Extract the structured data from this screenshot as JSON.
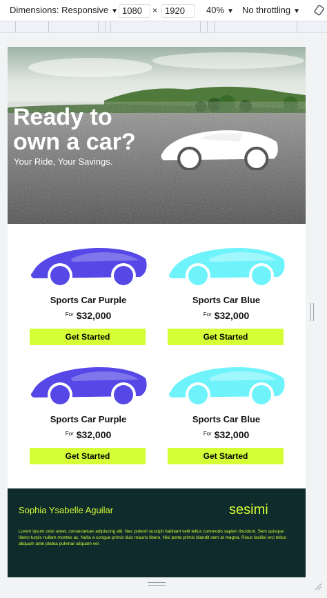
{
  "devtools": {
    "dimensions_label": "Dimensions: Responsive",
    "width_value": "1080",
    "times": "×",
    "height_value": "1920",
    "zoom_label": "40%",
    "throttling_label": "No throttling"
  },
  "hero": {
    "title_line1": "Ready to",
    "title_line2": "own a car?",
    "subtitle": "Your Ride, Your Savings."
  },
  "products": [
    {
      "name": "Sports Car Purple",
      "for": "For",
      "price": "$32,000",
      "button": "Get Started",
      "color": "#5548e6"
    },
    {
      "name": "Sports Car Blue",
      "for": "For",
      "price": "$32,000",
      "button": "Get Started",
      "color": "#6ef3fb"
    },
    {
      "name": "Sports Car Purple",
      "for": "For",
      "price": "$32,000",
      "button": "Get Started",
      "color": "#5548e6"
    },
    {
      "name": "Sports Car Blue",
      "for": "For",
      "price": "$32,000",
      "button": "Get Started",
      "color": "#6ef3fb"
    }
  ],
  "footer": {
    "author": "Sophia Ysabelle Aguilar",
    "brand": "sesimi",
    "lorem": "Lorem ipsum odor amet, consectetuer adipiscing elit. Nec potenti suscipit habitant velit tellus commodo sapien tincidunt. Sem quisque libero turpis nullam montes ac. Nulla a congue primis duis mauris libero. Nisi porta primis blandit sem at magna. Risus facilisi orci tellus aliquam ante platea pulvinar aliquam vel."
  },
  "colors": {
    "accent": "#d4ff36",
    "footer_bg": "#102b2b",
    "purple": "#5548e6",
    "cyan": "#6ef3fb"
  }
}
